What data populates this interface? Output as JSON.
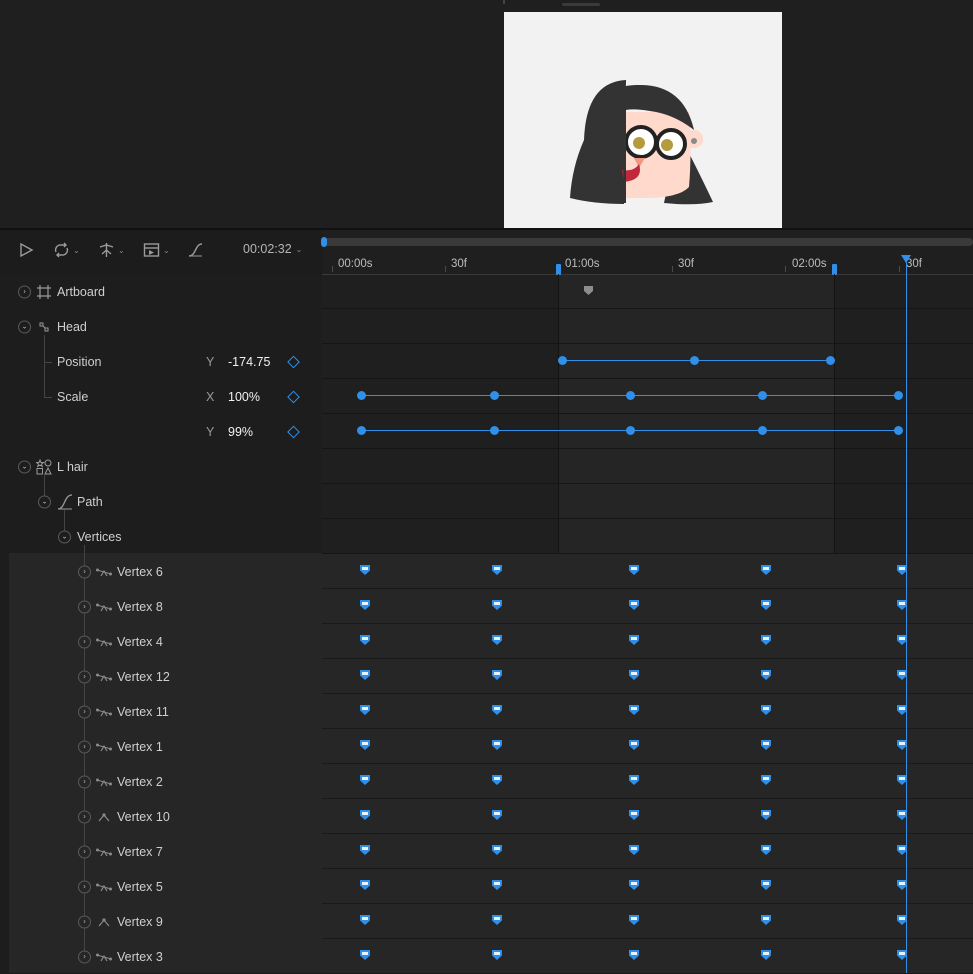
{
  "toolbar": {
    "timecode": "00:02:32",
    "tools": [
      "play-icon",
      "loop-icon",
      "snap-icon",
      "view-icon",
      "easing-icon"
    ]
  },
  "ruler": {
    "labels": [
      "00:00s",
      "30f",
      "01:00s",
      "30f",
      "02:00s",
      "30f"
    ]
  },
  "layers": {
    "artboard": "Artboard",
    "head": "Head",
    "position": {
      "label": "Position",
      "axis": "Y",
      "value": "-174.75"
    },
    "scale": {
      "label": "Scale",
      "x_axis": "X",
      "x_value": "100%",
      "y_axis": "Y",
      "y_value": "99%"
    },
    "lhair": "L hair",
    "path": "Path",
    "vertices": "Vertices",
    "vertex_items": [
      "Vertex 6",
      "Vertex 8",
      "Vertex 4",
      "Vertex 12",
      "Vertex 11",
      "Vertex 1",
      "Vertex 2",
      "Vertex 10",
      "Vertex 7",
      "Vertex 5",
      "Vertex 9",
      "Vertex 3"
    ]
  },
  "colors": {
    "accent": "#2f8fe9",
    "background": "#1b1b1b",
    "artboard": "#f2f2f2",
    "hair": "#333333",
    "skin": "#ffd9cc"
  }
}
